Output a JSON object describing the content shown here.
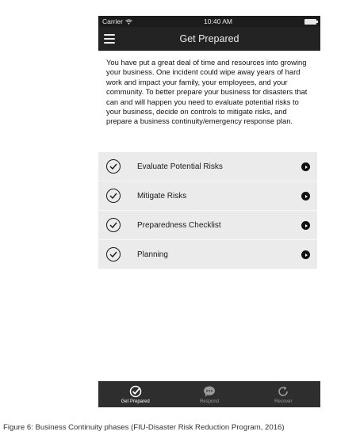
{
  "status_bar": {
    "carrier": "Carrier",
    "time": "10:40 AM"
  },
  "nav": {
    "title": "Get Prepared",
    "menu_icon": "hamburger-menu-icon"
  },
  "intro_text": "You have put a great deal of time and resources into growing your business. One incident could wipe away years of hard work and impact your family, your employees, and your community. To better prepare your business for disasters that can and will happen you need to evaluate potential risks to your business, decide on controls to mitigate risks, and prepare a business continuity/emergency response plan.",
  "list": {
    "items": [
      {
        "label": "Evaluate Potential Risks"
      },
      {
        "label": "Mitigate Risks"
      },
      {
        "label": "Preparedness Checklist"
      },
      {
        "label": "Planning"
      }
    ]
  },
  "tab_bar": {
    "tabs": [
      {
        "label": "Get Prepared",
        "icon": "check-circle-icon",
        "active": true
      },
      {
        "label": "Respond",
        "icon": "chat-bubble-icon",
        "active": false
      },
      {
        "label": "Recover",
        "icon": "refresh-icon",
        "active": false
      }
    ]
  },
  "caption": "Figure 6: Business Continuity phases (FIU-Disaster Risk Reduction Program, 2016)",
  "colors": {
    "nav_bg": "#232323",
    "list_bg": "#ebebeb",
    "tab_bg": "#2e2e2e"
  }
}
